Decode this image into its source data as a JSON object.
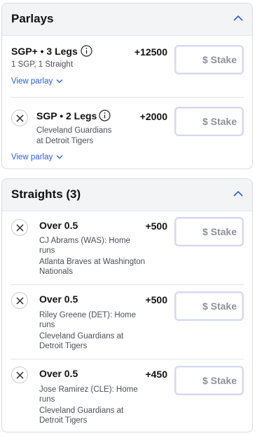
{
  "parlays": {
    "title": "Parlays",
    "items": [
      {
        "title": "SGP+ • 3 Legs",
        "odds": "+12500",
        "subtitle": "1 SGP, 1 Straight",
        "link": "View parlay",
        "stake_placeholder": "$ Stake"
      },
      {
        "title": "SGP • 2 Legs",
        "odds": "+2000",
        "game_line1": "Cleveland Guardians",
        "game_line2": "at Detroit Tigers",
        "link": "View parlay",
        "stake_placeholder": "$ Stake"
      }
    ]
  },
  "straights": {
    "title": "Straights (3)",
    "items": [
      {
        "title": "Over 0.5",
        "odds": "+500",
        "player_line1": "CJ Abrams (WAS): Home",
        "player_line2": "runs",
        "game_line1": "Atlanta Braves at Washington",
        "game_line2": "Nationals",
        "stake_placeholder": "$ Stake"
      },
      {
        "title": "Over 0.5",
        "odds": "+500",
        "player_line1": "Riley Greene (DET): Home",
        "player_line2": "runs",
        "game_line1": "Cleveland Guardians at",
        "game_line2": "Detroit Tigers",
        "stake_placeholder": "$ Stake"
      },
      {
        "title": "Over 0.5",
        "odds": "+450",
        "player_line1": "Jose Ramirez (CLE): Home",
        "player_line2": "runs",
        "game_line1": "Cleveland Guardians at",
        "game_line2": "Detroit Tigers",
        "stake_placeholder": "$ Stake"
      }
    ]
  },
  "icons": {
    "collapse": "chevron-up-icon",
    "info": "info-icon",
    "expand": "chevron-down-icon",
    "remove": "close-icon"
  },
  "colors": {
    "link": "#2a5fd8",
    "header_bg": "#f3f4f6",
    "stake_border": "#d6d8f0"
  }
}
